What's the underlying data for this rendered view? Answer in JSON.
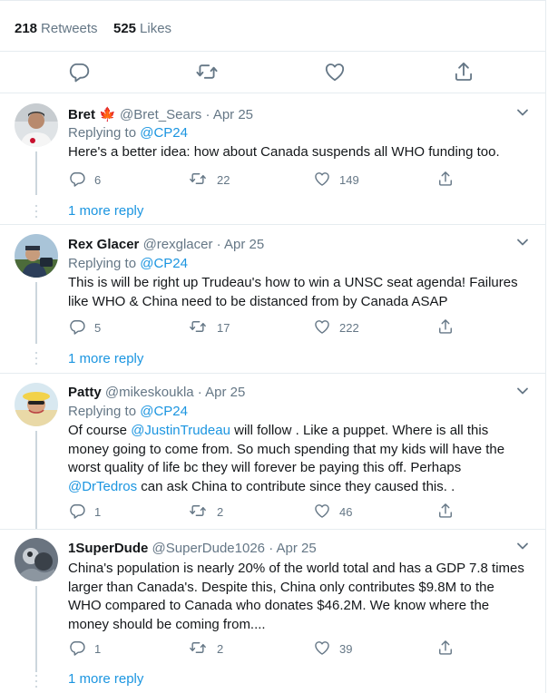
{
  "stats": {
    "retweets_count": "218",
    "retweets_label": "Retweets",
    "likes_count": "525",
    "likes_label": "Likes"
  },
  "icons": {
    "reply": "reply-icon",
    "retweet": "retweet-icon",
    "like": "heart-icon",
    "share": "share-icon",
    "caret": "chevron-down-icon"
  },
  "colors": {
    "link": "#1b95e0",
    "muted": "#657786",
    "flag": "#e0245e"
  },
  "replying_label": "Replying to",
  "more_reply_label": "1 more reply",
  "tweets": [
    {
      "name": "Bret",
      "flag": "🍁",
      "handle": "@Bret_Sears",
      "sep": "·",
      "date": "Apr 25",
      "reply_to": "@CP24",
      "text": "Here's a better idea: how about Canada suspends all WHO funding too.",
      "replies": "6",
      "retweets": "22",
      "likes": "149"
    },
    {
      "name": "Rex Glacer",
      "handle": "@rexglacer",
      "sep": "·",
      "date": "Apr 25",
      "reply_to": "@CP24",
      "text": "This is will be right up Trudeau's how to win a UNSC seat agenda! Failures like WHO & China need to be distanced from by Canada ASAP",
      "replies": "5",
      "retweets": "17",
      "likes": "222"
    },
    {
      "name": "Patty",
      "handle": "@mikeskoukla",
      "sep": "·",
      "date": "Apr 25",
      "reply_to": "@CP24",
      "text_parts": [
        "Of course ",
        "@JustinTrudeau",
        " will follow . Like a puppet. Where is all this money going to come from. So much spending that my kids  will have the worst quality of life bc they will forever be paying this off. Perhaps ",
        "@DrTedros",
        " can ask China to contribute since they caused this. ."
      ],
      "replies": "1",
      "retweets": "2",
      "likes": "46"
    },
    {
      "name": "1SuperDude",
      "handle": "@SuperDude1026",
      "sep": "·",
      "date": "Apr 25",
      "text": "China's population is nearly 20% of the world total and has a GDP 7.8 times larger than Canada's. Despite this, China only contributes $9.8M to the WHO compared to Canada who donates $46.2M. We know where the money should be coming from....",
      "replies": "1",
      "retweets": "2",
      "likes": "39"
    }
  ]
}
